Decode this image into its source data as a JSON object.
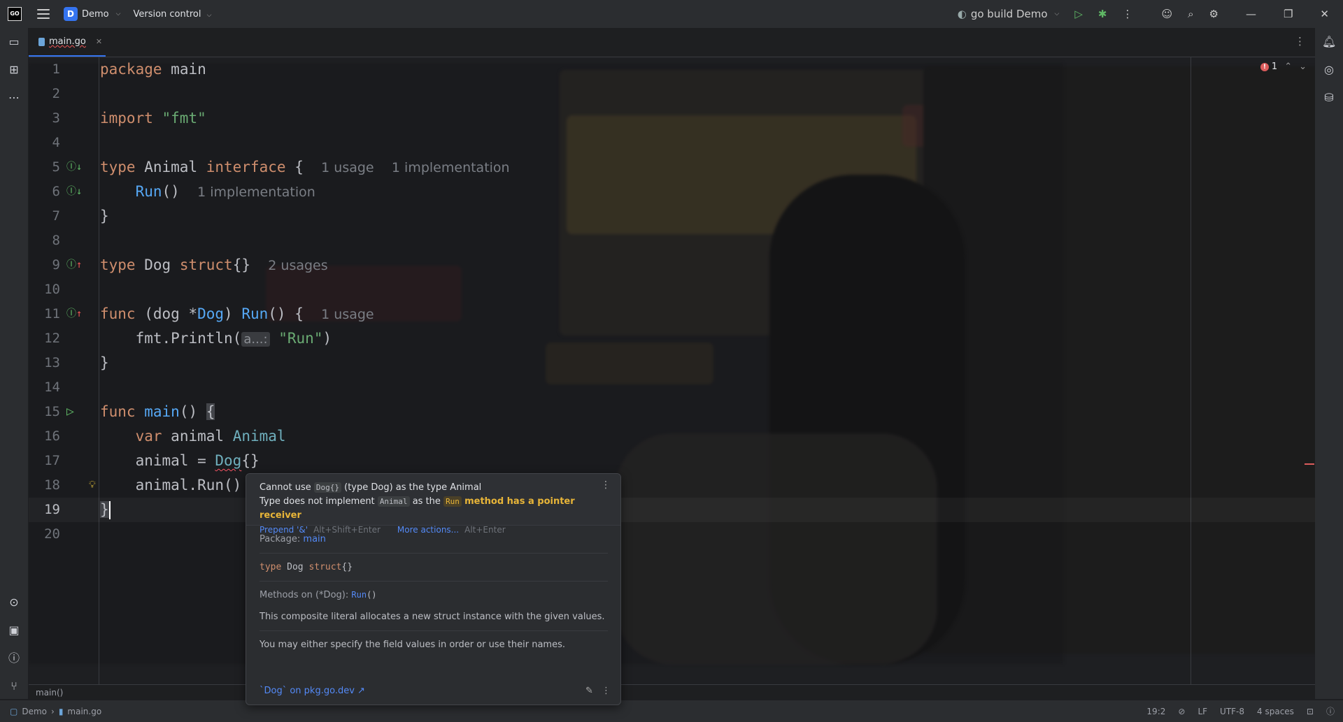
{
  "topbar": {
    "logo": "GO",
    "project_badge": "D",
    "project_name": "Demo",
    "version_control": "Version control",
    "run_config": "go build Demo"
  },
  "tab": {
    "filename": "main.go"
  },
  "editor": {
    "lines": [
      {
        "n": "1"
      },
      {
        "n": "2"
      },
      {
        "n": "3"
      },
      {
        "n": "4"
      },
      {
        "n": "5"
      },
      {
        "n": "6"
      },
      {
        "n": "7"
      },
      {
        "n": "8"
      },
      {
        "n": "9"
      },
      {
        "n": "10"
      },
      {
        "n": "11"
      },
      {
        "n": "12"
      },
      {
        "n": "13"
      },
      {
        "n": "14"
      },
      {
        "n": "15"
      },
      {
        "n": "16"
      },
      {
        "n": "17"
      },
      {
        "n": "18"
      },
      {
        "n": "19"
      },
      {
        "n": "20"
      }
    ],
    "code": {
      "l1_kw": "package",
      "l1_id": "main",
      "l3_kw": "import",
      "l3_str": "\"fmt\"",
      "l5_kw": "type",
      "l5_name": "Animal",
      "l5_kw2": "interface",
      "l5_brace": "{",
      "l5_hint1": "1 usage",
      "l5_hint2": "1 implementation",
      "l6_fn": "Run",
      "l6_paren": "()",
      "l6_hint": "1 implementation",
      "l7": "}",
      "l9_kw": "type",
      "l9_name": "Dog",
      "l9_kw2": "struct",
      "l9_braces": "{}",
      "l9_hint": "2 usages",
      "l11_kw": "func",
      "l11_recv_open": "(dog *",
      "l11_recv_type": "Dog",
      "l11_recv_close": ")",
      "l11_fn": "Run",
      "l11_rest": "() {",
      "l11_hint": "1 usage",
      "l12_pkg": "fmt.",
      "l12_fn": "Println",
      "l12_open": "(",
      "l12_param": "a...:",
      "l12_str": "\"Run\"",
      "l12_close": ")",
      "l13": "}",
      "l15_kw": "func",
      "l15_fn": "main",
      "l15_rest": "() ",
      "l15_brace": "{",
      "l16_kw": "var",
      "l16_id": "animal",
      "l16_ty": "Animal",
      "l17_id": "animal = ",
      "l17_ty": "Dog",
      "l17_rest": "{}",
      "l18_id": "animal.",
      "l18_fn": "Run",
      "l18_rest": "()",
      "l19": "}"
    },
    "error_count": "1"
  },
  "popup": {
    "msg1_a": "Cannot use",
    "msg1_chip": "Dog{}",
    "msg1_b": "(type Dog) as the type Animal",
    "msg2_a": "Type does not implement",
    "msg2_chip1": "Animal",
    "msg2_b": "as the",
    "msg2_chip2": "Run",
    "msg2_warn": "method has a pointer receiver",
    "action1": "Prepend '&'",
    "action1_keys": "Alt+Shift+Enter",
    "action2": "More actions...",
    "action2_keys": "Alt+Enter",
    "package_label": "Package:",
    "package_value": "main",
    "decl_kw": "type",
    "decl_name": "Dog",
    "decl_kw2": "struct",
    "decl_braces": "{}",
    "methods_label": "Methods on (*Dog):",
    "methods_fn": "Run",
    "methods_paren": "()",
    "desc1": "This composite literal allocates a new struct instance with the given values.",
    "desc2": "You may either specify the field values in order or use their names.",
    "doc_link": "`Dog` on pkg.go.dev ↗"
  },
  "breadcrumb": "main()",
  "status": {
    "project": "Demo",
    "file": "main.go",
    "position": "19:2",
    "line_sep": "LF",
    "encoding": "UTF-8",
    "indent": "4 spaces"
  },
  "colors": {
    "accent": "#3574f0",
    "error": "#db5c5c",
    "keyword": "#cf8e6d",
    "string": "#6aab73",
    "function": "#56a8f5"
  },
  "icons": [
    "folder-icon",
    "structure-icon",
    "more-icon",
    "services-icon",
    "terminal-icon",
    "problems-icon",
    "git-icon",
    "run-icon",
    "debug-icon",
    "kebab-icon",
    "add-user-icon",
    "search-icon",
    "settings-icon",
    "minimize-icon",
    "maximize-icon",
    "close-icon",
    "notifications-icon",
    "ai-icon",
    "database-icon",
    "bulb-icon",
    "edit-icon",
    "lock-icon",
    "reader-mode-icon",
    "inspections-icon"
  ]
}
